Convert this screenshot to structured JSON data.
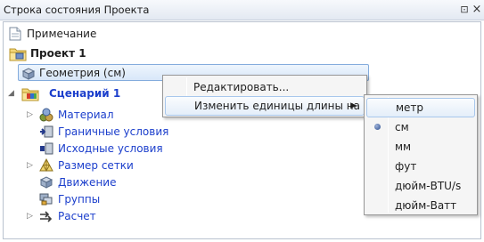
{
  "panel": {
    "title": "Строка состояния Проекта",
    "pin_glyph": "⊡",
    "close_glyph": "×"
  },
  "tree": {
    "note": "Примечание",
    "project": "Проект 1",
    "geometry": "Геометрия (см)",
    "scenario": "Сценарий 1",
    "children": [
      {
        "label": "Материал",
        "icon": "material-icon"
      },
      {
        "label": "Граничные условия",
        "icon": "boundary-conditions-icon"
      },
      {
        "label": "Исходные условия",
        "icon": "initial-conditions-icon"
      },
      {
        "label": "Размер сетки",
        "icon": "mesh-size-icon"
      },
      {
        "label": "Движение",
        "icon": "motion-icon"
      },
      {
        "label": "Группы",
        "icon": "groups-icon"
      },
      {
        "label": "Расчет",
        "icon": "solve-icon"
      }
    ]
  },
  "context_menu": {
    "items": [
      "Редактировать...",
      "Изменить единицы длины на"
    ],
    "submenu_arrow": "▶"
  },
  "units_menu": {
    "items": [
      "метр",
      "см",
      "мм",
      "фут",
      "дюйм-BTU/s",
      "дюйм-Ватт"
    ],
    "selected": "см",
    "highlighted": "метр"
  },
  "colors": {
    "link_text": "#1c3fcc",
    "selection_border": "#84acdd",
    "menu_background": "#f5f5f5"
  }
}
